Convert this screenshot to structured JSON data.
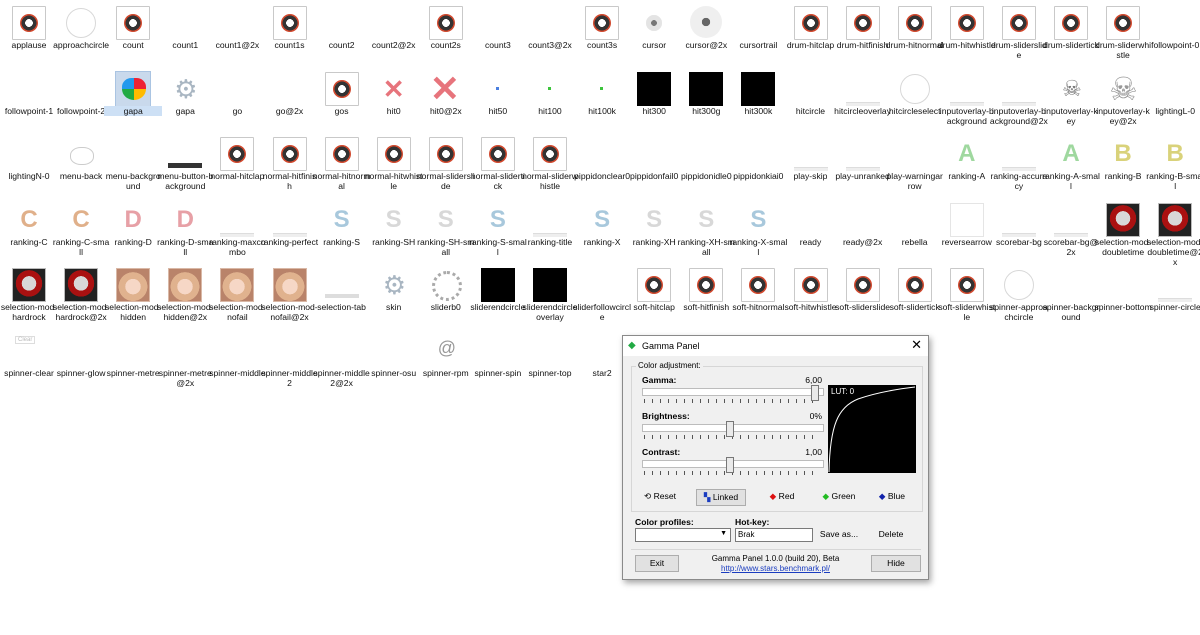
{
  "desktop": {
    "icons": [
      {
        "label": "applause",
        "kind": "audio"
      },
      {
        "label": "approachcircle",
        "kind": "circle"
      },
      {
        "label": "count",
        "kind": "audio"
      },
      {
        "label": "count1",
        "kind": "blank"
      },
      {
        "label": "count1@2x",
        "kind": "blank"
      },
      {
        "label": "count1s",
        "kind": "audio"
      },
      {
        "label": "count2",
        "kind": "blank"
      },
      {
        "label": "count2@2x",
        "kind": "blank"
      },
      {
        "label": "count2s",
        "kind": "audio"
      },
      {
        "label": "count3",
        "kind": "blank"
      },
      {
        "label": "count3@2x",
        "kind": "blank"
      },
      {
        "label": "count3s",
        "kind": "audio"
      },
      {
        "label": "cursor",
        "kind": "cursor"
      },
      {
        "label": "cursor@2x",
        "kind": "cursorbig"
      },
      {
        "label": "cursortrail",
        "kind": "blank"
      },
      {
        "label": "drum-hitclap",
        "kind": "audio"
      },
      {
        "label": "drum-hitfinish",
        "kind": "audio"
      },
      {
        "label": "drum-hitnormal",
        "kind": "audio"
      },
      {
        "label": "drum-hitwhistle",
        "kind": "audio"
      },
      {
        "label": "drum-sliderslide",
        "kind": "audio"
      },
      {
        "label": "drum-slidertick",
        "kind": "audio"
      },
      {
        "label": "drum-sliderwhistle",
        "kind": "audio"
      },
      {
        "label": "followpoint-0",
        "kind": "blank"
      },
      {
        "label": "followpoint-1",
        "kind": "blank"
      },
      {
        "label": "followpoint-2",
        "kind": "blank"
      },
      {
        "label": "gapa",
        "kind": "butterfly"
      },
      {
        "label": "gapa",
        "kind": "gear"
      },
      {
        "label": "go",
        "kind": "blank"
      },
      {
        "label": "go@2x",
        "kind": "blank"
      },
      {
        "label": "gos",
        "kind": "audio"
      },
      {
        "label": "hit0",
        "kind": "hitx"
      },
      {
        "label": "hit0@2x",
        "kind": "hitxbig"
      },
      {
        "label": "hit50",
        "kind": "dot",
        "color": "#4a7fe0"
      },
      {
        "label": "hit100",
        "kind": "dot",
        "color": "#3cc43c"
      },
      {
        "label": "hit100k",
        "kind": "dot",
        "color": "#3cc43c"
      },
      {
        "label": "hit300",
        "kind": "black"
      },
      {
        "label": "hit300g",
        "kind": "black"
      },
      {
        "label": "hit300k",
        "kind": "black"
      },
      {
        "label": "hitcircle",
        "kind": "blank"
      },
      {
        "label": "hitcircleoverlay",
        "kind": "thinline"
      },
      {
        "label": "hitcircleselect",
        "kind": "circle"
      },
      {
        "label": "inputoverlay-background",
        "kind": "thinline"
      },
      {
        "label": "inputoverlay-background@2x",
        "kind": "thinline"
      },
      {
        "label": "inputoverlay-key",
        "kind": "skull"
      },
      {
        "label": "inputoverlay-key@2x",
        "kind": "skullbig"
      },
      {
        "label": "lightingL-0",
        "kind": "blank"
      },
      {
        "label": "lightingN-0",
        "kind": "blank"
      },
      {
        "label": "menu-back",
        "kind": "kitty"
      },
      {
        "label": "menu-background",
        "kind": "blank"
      },
      {
        "label": "menu-button-background",
        "kind": "bar"
      },
      {
        "label": "normal-hitclap",
        "kind": "audio"
      },
      {
        "label": "normal-hitfinish",
        "kind": "audio"
      },
      {
        "label": "normal-hitnormal",
        "kind": "audio"
      },
      {
        "label": "normal-hitwhistle",
        "kind": "audio"
      },
      {
        "label": "normal-sliderslide",
        "kind": "audio"
      },
      {
        "label": "normal-slidertick",
        "kind": "audio"
      },
      {
        "label": "normal-sliderwhistle",
        "kind": "audio"
      },
      {
        "label": "pippidonclear0",
        "kind": "blank"
      },
      {
        "label": "pippidonfail0",
        "kind": "blank"
      },
      {
        "label": "pippidonidle0",
        "kind": "blank"
      },
      {
        "label": "pippidonkiai0",
        "kind": "blank"
      },
      {
        "label": "play-skip",
        "kind": "thinline"
      },
      {
        "label": "play-unranked",
        "kind": "thinline"
      },
      {
        "label": "play-warningarrow",
        "kind": "blank"
      },
      {
        "label": "ranking-A",
        "kind": "rank",
        "glyph": "A",
        "color": "#9fd89f"
      },
      {
        "label": "ranking-accuracy",
        "kind": "thinline"
      },
      {
        "label": "ranking-A-small",
        "kind": "rank",
        "glyph": "A",
        "color": "#9fd89f"
      },
      {
        "label": "ranking-B",
        "kind": "rank",
        "glyph": "B",
        "color": "#d9d27a"
      },
      {
        "label": "ranking-B-small",
        "kind": "rank",
        "glyph": "B",
        "color": "#d9d27a"
      },
      {
        "label": "ranking-C",
        "kind": "rank",
        "glyph": "C",
        "color": "#e0b08a"
      },
      {
        "label": "ranking-C-small",
        "kind": "rank",
        "glyph": "C",
        "color": "#e0b08a"
      },
      {
        "label": "ranking-D",
        "kind": "rank",
        "glyph": "D",
        "color": "#e7a0a6"
      },
      {
        "label": "ranking-D-small",
        "kind": "rank",
        "glyph": "D",
        "color": "#e7a0a6"
      },
      {
        "label": "ranking-maxcombo",
        "kind": "thinline"
      },
      {
        "label": "ranking-perfect",
        "kind": "thinline"
      },
      {
        "label": "ranking-S",
        "kind": "rank",
        "glyph": "S",
        "color": "#a8c8dc"
      },
      {
        "label": "ranking-SH",
        "kind": "rank",
        "glyph": "S",
        "color": "#d8d8d8"
      },
      {
        "label": "ranking-SH-small",
        "kind": "rank",
        "glyph": "S",
        "color": "#d8d8d8"
      },
      {
        "label": "ranking-S-small",
        "kind": "rank",
        "glyph": "S",
        "color": "#a8c8dc"
      },
      {
        "label": "ranking-title",
        "kind": "thinline"
      },
      {
        "label": "ranking-X",
        "kind": "rank",
        "glyph": "S",
        "color": "#a8c8dc"
      },
      {
        "label": "ranking-XH",
        "kind": "rank",
        "glyph": "S",
        "color": "#d8d8d8"
      },
      {
        "label": "ranking-XH-small",
        "kind": "rank",
        "glyph": "S",
        "color": "#d8d8d8"
      },
      {
        "label": "ranking-X-small",
        "kind": "rank",
        "glyph": "S",
        "color": "#a8c8dc"
      },
      {
        "label": "ready",
        "kind": "blank"
      },
      {
        "label": "ready@2x",
        "kind": "blank"
      },
      {
        "label": "rebella",
        "kind": "blank"
      },
      {
        "label": "reversearrow",
        "kind": "png"
      },
      {
        "label": "scorebar-bg",
        "kind": "thinline"
      },
      {
        "label": "scorebar-bg@2x",
        "kind": "thinline"
      },
      {
        "label": "selection-mod-doubletime",
        "kind": "mod"
      },
      {
        "label": "selection-mod-doubletime@2x",
        "kind": "mod"
      },
      {
        "label": "selection-mod-hardrock",
        "kind": "mod"
      },
      {
        "label": "selection-mod-hardrock@2x",
        "kind": "mod"
      },
      {
        "label": "selection-mod-hidden",
        "kind": "face"
      },
      {
        "label": "selection-mod-hidden@2x",
        "kind": "face"
      },
      {
        "label": "selection-mod-nofail",
        "kind": "face"
      },
      {
        "label": "selection-mod-nofail@2x",
        "kind": "face"
      },
      {
        "label": "selection-tab",
        "kind": "thinbar"
      },
      {
        "label": "skin",
        "kind": "gear"
      },
      {
        "label": "sliderb0",
        "kind": "ring"
      },
      {
        "label": "sliderendcircle",
        "kind": "black"
      },
      {
        "label": "sliderendcircleoverlay",
        "kind": "black"
      },
      {
        "label": "sliderfollowcircle",
        "kind": "blank"
      },
      {
        "label": "soft-hitclap",
        "kind": "audio"
      },
      {
        "label": "soft-hitfinish",
        "kind": "audio"
      },
      {
        "label": "soft-hitnormal",
        "kind": "audio"
      },
      {
        "label": "soft-hitwhistle",
        "kind": "audio"
      },
      {
        "label": "soft-sliderslide",
        "kind": "audio"
      },
      {
        "label": "soft-slidertick",
        "kind": "audio"
      },
      {
        "label": "soft-sliderwhistle",
        "kind": "audio"
      },
      {
        "label": "spinner-approachcircle",
        "kind": "circle"
      },
      {
        "label": "spinner-background",
        "kind": "blank"
      },
      {
        "label": "spinner-bottom",
        "kind": "blank"
      },
      {
        "label": "spinner-circle",
        "kind": "thinline"
      },
      {
        "label": "spinner-clear",
        "kind": "smalltxt"
      },
      {
        "label": "spinner-glow",
        "kind": "blank"
      },
      {
        "label": "spinner-metre",
        "kind": "blank"
      },
      {
        "label": "spinner-metre@2x",
        "kind": "blank"
      },
      {
        "label": "spinner-middle",
        "kind": "blank"
      },
      {
        "label": "spinner-middle2",
        "kind": "blank"
      },
      {
        "label": "spinner-middle2@2x",
        "kind": "blank"
      },
      {
        "label": "spinner-osu",
        "kind": "blank"
      },
      {
        "label": "spinner-rpm",
        "kind": "spiral"
      },
      {
        "label": "spinner-spin",
        "kind": "blank"
      },
      {
        "label": "spinner-top",
        "kind": "blank"
      },
      {
        "label": "star2",
        "kind": "blank"
      }
    ]
  },
  "gamma_panel": {
    "title": "Gamma Panel",
    "close": "✕",
    "group_label": "Color adjustment:",
    "gamma": {
      "label": "Gamma:",
      "value": "6,00",
      "level": 0.97
    },
    "brightness": {
      "label": "Brightness:",
      "value": "0%",
      "level": 0.48
    },
    "contrast": {
      "label": "Contrast:",
      "value": "1,00",
      "level": 0.48
    },
    "lut": "LUT: 0",
    "buttons": {
      "reset": "Reset",
      "linked": "Linked",
      "red": "Red",
      "green": "Green",
      "blue": "Blue"
    },
    "profiles_label": "Color profiles:",
    "hotkey_label": "Hot-key:",
    "hotkey_value": "Brak",
    "save_as": "Save as...",
    "delete": "Delete",
    "exit": "Exit",
    "hide": "Hide",
    "version": "Gamma Panel 1.0.0 (build 20), Beta",
    "url": "http://www.stars.benchmark.pl/"
  }
}
